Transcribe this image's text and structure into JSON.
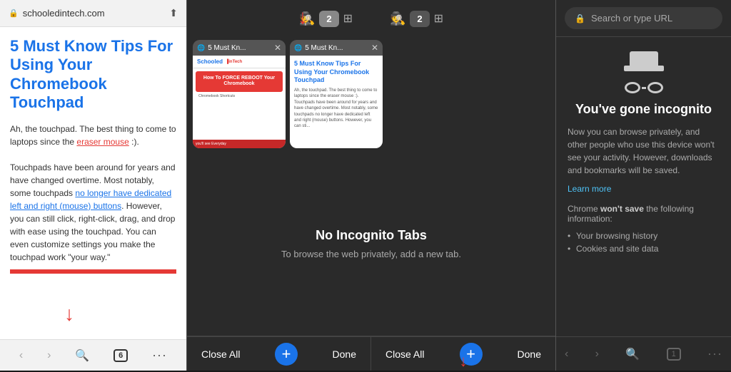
{
  "left_panel": {
    "address_bar": {
      "url": "schooledintech.com",
      "lock_icon": "🔒",
      "share_icon": "⬆"
    },
    "page": {
      "title": "5 Must Know Tips For Using Your Chromebook Touchpad",
      "body_intro": "Ah, the touchpad. The best thing to come to laptops since the ",
      "link1": "eraser mouse",
      "link1_suffix": " :).",
      "body2": "Touchpads have been around for years and have changed overtime. Most notably, some touchpads ",
      "link2": "no longer have dedicated left and right (mouse) buttons",
      "body3": ". However, you can still click, right-click, drag, and drop with ease using the touchpad. You can even customize settings you make the touchpad work \"your way.\""
    },
    "bottom_bar": {
      "back": "‹",
      "forward": "›",
      "search": "🔍",
      "tabs": "6",
      "more": "···"
    }
  },
  "middle_panel": {
    "toolbar": {
      "incognito_icon": "🕵",
      "normal_tabs": "2",
      "grid_icon": "⊞",
      "incognito_tabs": "2"
    },
    "tabs": [
      {
        "title": "5 Must Kn...",
        "close": "✕"
      },
      {
        "title": "5 Must Kn...",
        "close": "✕"
      }
    ],
    "no_incognito": {
      "title": "No Incognito Tabs",
      "subtitle": "To browse the web privately, add a new tab."
    },
    "normal_bottom": {
      "close_all": "Close All",
      "done": "Done"
    },
    "incognito_bottom": {
      "close_all": "Close All",
      "done": "Done",
      "add": "+"
    }
  },
  "right_panel": {
    "search_placeholder": "Search or type URL",
    "incognito": {
      "title": "You've gone incognito",
      "description": "Now you can browse privately, and other people who use this device won't see your activity. However, downloads and bookmarks will be saved.",
      "learn_more": "Learn more",
      "wont_save_intro": "Chrome ",
      "wont_save_bold": "won't save",
      "wont_save_suffix": " the following information:",
      "items": [
        "Your browsing history",
        "Cookies and site data"
      ]
    },
    "bottom_bar": {
      "back": "‹",
      "forward": "›",
      "search": "🔍",
      "tabs": "1",
      "more": "···"
    }
  }
}
